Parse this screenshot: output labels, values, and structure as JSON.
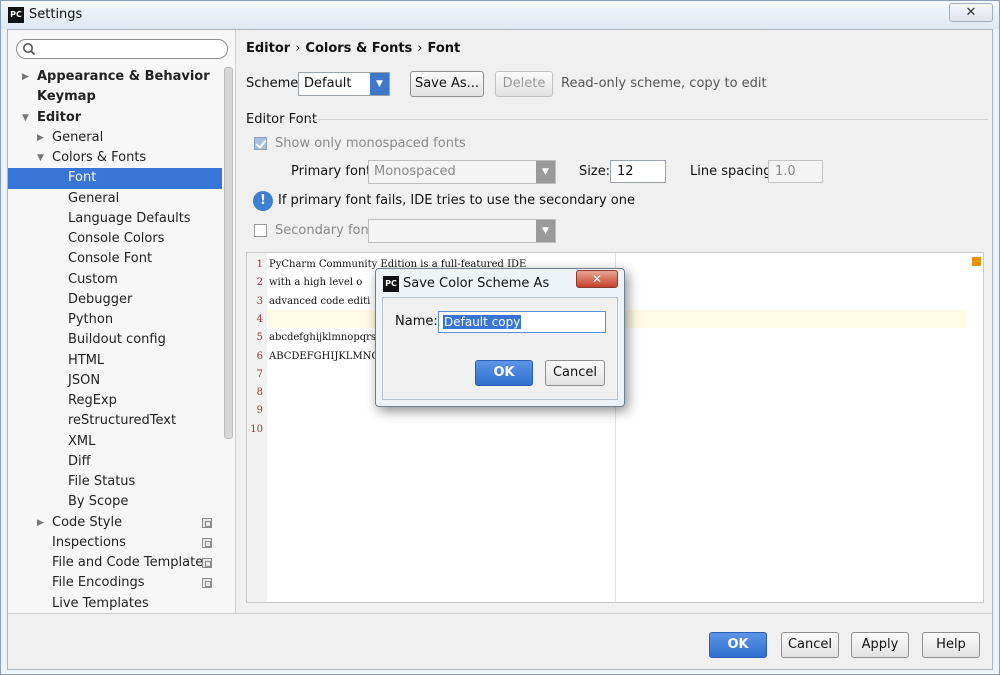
{
  "window": {
    "title": "Settings",
    "app_icon": "PC",
    "close_glyph": "✕"
  },
  "search": {
    "placeholder": ""
  },
  "sidebar": {
    "items": [
      {
        "label": "Appearance & Behavior",
        "level": 0,
        "bold": true,
        "arrow": "▶",
        "name": "sidebar-item-appearance-behavior"
      },
      {
        "label": "Keymap",
        "level": 0,
        "bold": true,
        "arrow": "",
        "name": "sidebar-item-keymap"
      },
      {
        "label": "Editor",
        "level": 0,
        "bold": true,
        "arrow": "▼",
        "name": "sidebar-item-editor"
      },
      {
        "label": "General",
        "level": 1,
        "arrow": "▶",
        "name": "sidebar-item-general"
      },
      {
        "label": "Colors & Fonts",
        "level": 1,
        "arrow": "▼",
        "name": "sidebar-item-colors-fonts"
      },
      {
        "label": "Font",
        "level": 2,
        "selected": true,
        "name": "sidebar-item-font"
      },
      {
        "label": "General",
        "level": 2,
        "name": "sidebar-item-colors-general"
      },
      {
        "label": "Language Defaults",
        "level": 2,
        "name": "sidebar-item-language-defaults"
      },
      {
        "label": "Console Colors",
        "level": 2,
        "name": "sidebar-item-console-colors"
      },
      {
        "label": "Console Font",
        "level": 2,
        "name": "sidebar-item-console-font"
      },
      {
        "label": "Custom",
        "level": 2,
        "name": "sidebar-item-custom"
      },
      {
        "label": "Debugger",
        "level": 2,
        "name": "sidebar-item-debugger"
      },
      {
        "label": "Python",
        "level": 2,
        "name": "sidebar-item-python"
      },
      {
        "label": "Buildout config",
        "level": 2,
        "name": "sidebar-item-buildout-config"
      },
      {
        "label": "HTML",
        "level": 2,
        "name": "sidebar-item-html"
      },
      {
        "label": "JSON",
        "level": 2,
        "name": "sidebar-item-json"
      },
      {
        "label": "RegExp",
        "level": 2,
        "name": "sidebar-item-regexp"
      },
      {
        "label": "reStructuredText",
        "level": 2,
        "name": "sidebar-item-restructuredtext"
      },
      {
        "label": "XML",
        "level": 2,
        "name": "sidebar-item-xml"
      },
      {
        "label": "Diff",
        "level": 2,
        "name": "sidebar-item-diff"
      },
      {
        "label": "File Status",
        "level": 2,
        "name": "sidebar-item-file-status"
      },
      {
        "label": "By Scope",
        "level": 2,
        "name": "sidebar-item-by-scope"
      },
      {
        "label": "Code Style",
        "level": 1,
        "arrow": "▶",
        "copy": true,
        "name": "sidebar-item-code-style"
      },
      {
        "label": "Inspections",
        "level": 1,
        "copy": true,
        "name": "sidebar-item-inspections"
      },
      {
        "label": "File and Code Templates",
        "level": 1,
        "copy": true,
        "name": "sidebar-item-file-code-templates"
      },
      {
        "label": "File Encodings",
        "level": 1,
        "copy": true,
        "name": "sidebar-item-file-encodings"
      },
      {
        "label": "Live Templates",
        "level": 1,
        "name": "sidebar-item-live-templates"
      }
    ]
  },
  "breadcrumb": {
    "part1": "Editor",
    "part2": "Colors & Fonts",
    "part3": "Font",
    "sep": "›"
  },
  "scheme": {
    "label": "Scheme:",
    "value": "Default",
    "save_as": "Save As...",
    "delete": "Delete",
    "note": "Read-only scheme, copy to edit"
  },
  "editor_font": {
    "section_title": "Editor Font",
    "show_mono_label": "Show only monospaced fonts",
    "primary_label": "Primary font:",
    "primary_value": "Monospaced",
    "size_label": "Size:",
    "size_value": "12",
    "spacing_label": "Line spacing:",
    "spacing_value": "1.0",
    "info_text": "If primary font fails, IDE tries to use the secondary one",
    "secondary_label": "Secondary font:",
    "secondary_value": ""
  },
  "preview": {
    "lines": [
      {
        "n": "1",
        "text": "PyCharm Community Edition is a full-featured IDE"
      },
      {
        "n": "2",
        "text": "with a high level o"
      },
      {
        "n": "3",
        "text": "advanced code editi"
      },
      {
        "n": "4",
        "text": ""
      },
      {
        "n": "5",
        "text": "abcdefghijklmnopqrs"
      },
      {
        "n": "6",
        "text": "ABCDEFGHIJKLMNOPQRS"
      },
      {
        "n": "7",
        "text": ""
      },
      {
        "n": "8",
        "text": ""
      },
      {
        "n": "9",
        "text": ""
      },
      {
        "n": "10",
        "text": ""
      }
    ]
  },
  "footer": {
    "ok": "OK",
    "cancel": "Cancel",
    "apply": "Apply",
    "help": "Help"
  },
  "dialog": {
    "title": "Save Color Scheme As",
    "icon": "PC",
    "close_glyph": "✕",
    "name_label": "Name:",
    "name_value": "Default copy",
    "ok": "OK",
    "cancel": "Cancel"
  },
  "info_glyph": "!",
  "dropdown_glyph": "▼"
}
